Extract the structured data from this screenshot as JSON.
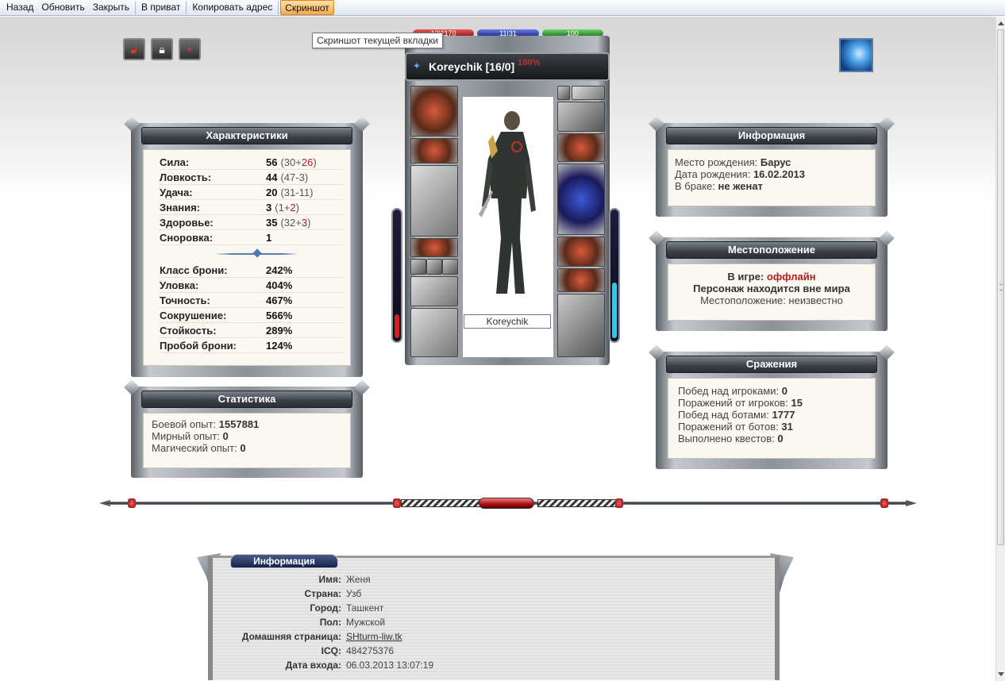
{
  "toolbar": {
    "items": [
      "Назад",
      "Обновить",
      "Закрыть",
      "В приват",
      "Копировать адрес",
      "Скриншот"
    ],
    "active": "Скриншот"
  },
  "tooltip": "Скриншот текущей вкладки",
  "character": {
    "name": "Koreychik [16/0]",
    "percent": "100%",
    "bars": {
      "hp": "1170",
      "hp_prefix": "13|",
      "mana": "11|31",
      "stamina": "100"
    },
    "portrait_label": "Koreychik"
  },
  "characteristics": {
    "title": "Характеристики",
    "rows": [
      {
        "label": "Сила:",
        "value": "56",
        "base": "(30+",
        "plus": "26",
        "close": ")"
      },
      {
        "label": "Ловкость:",
        "value": "44",
        "base": "(47-3)",
        "plus": "",
        "close": ""
      },
      {
        "label": "Удача:",
        "value": "20",
        "base": "(31-11)",
        "plus": "",
        "close": ""
      },
      {
        "label": "Знания:",
        "value": "3",
        "base": "(1+",
        "plus": "2",
        "close": ")"
      },
      {
        "label": "Здоровье:",
        "value": "35",
        "base": "(32+",
        "plus": "3",
        "close": ")"
      },
      {
        "label": "Сноровка:",
        "value": "1",
        "base": "",
        "plus": "",
        "close": ""
      }
    ],
    "combat": [
      {
        "label": "Класс брони:",
        "value": "242%"
      },
      {
        "label": "Уловка:",
        "value": "404%"
      },
      {
        "label": "Точность:",
        "value": "467%"
      },
      {
        "label": "Сокрушение:",
        "value": "566%"
      },
      {
        "label": "Стойкость:",
        "value": "289%"
      },
      {
        "label": "Пробой брони:",
        "value": "124%"
      }
    ]
  },
  "statistics": {
    "title": "Статистика",
    "rows": [
      {
        "label": "Боевой опыт:",
        "value": "1557881"
      },
      {
        "label": "Мирный опыт:",
        "value": "0"
      },
      {
        "label": "Магический опыт:",
        "value": "0"
      }
    ]
  },
  "information": {
    "title": "Информация",
    "rows": [
      {
        "label": "Место рождения:",
        "value": "Барус"
      },
      {
        "label": "Дата рождения:",
        "value": "16.02.2013"
      },
      {
        "label": "В браке:",
        "value": "не женат"
      }
    ]
  },
  "location": {
    "title": "Местоположение",
    "in_game_label": "В игре:",
    "in_game_value": "оффлайн",
    "line2": "Персонаж находится вне мира",
    "line3": "Местоположение: неизвестно"
  },
  "battles": {
    "title": "Сражения",
    "rows": [
      {
        "label": "Побед над игроками:",
        "value": "0"
      },
      {
        "label": "Поражений от игроков:",
        "value": "15"
      },
      {
        "label": "Побед над ботами:",
        "value": "1777"
      },
      {
        "label": "Поражений от ботов:",
        "value": "31"
      },
      {
        "label": "Выполнено квестов:",
        "value": "0"
      }
    ]
  },
  "personal": {
    "tab": "Информация",
    "rows": [
      {
        "label": "Имя:",
        "value": "Женя"
      },
      {
        "label": "Страна:",
        "value": "Узб"
      },
      {
        "label": "Город:",
        "value": "Ташкент"
      },
      {
        "label": "Пол:",
        "value": "Мужской"
      },
      {
        "label": "Домашняя страница:",
        "value": "SHturm-liw.tk"
      },
      {
        "label": "ICQ:",
        "value": "484275376"
      },
      {
        "label": "Дата входа:",
        "value": "06.03.2013 13:07:19"
      }
    ]
  }
}
